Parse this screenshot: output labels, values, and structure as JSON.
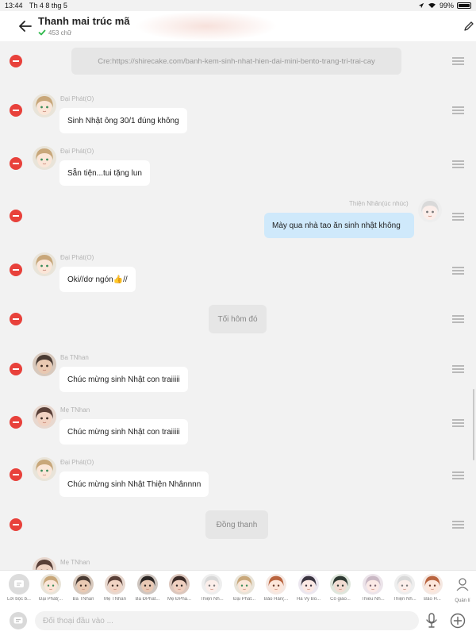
{
  "status_bar": {
    "time": "13:44",
    "date": "Th 4 8 thg 5",
    "battery": "99%"
  },
  "header": {
    "title": "Thanh mai trúc mã",
    "word_count": "453 chữ"
  },
  "messages": [
    {
      "type": "system",
      "text": "Cre:https://shirecake.com/banh-kem-sinh-nhat-hien-dai-mini-bento-trang-tri-trai-cay"
    },
    {
      "type": "left",
      "sender": "Đại Phát(O)",
      "text": "Sinh Nhật ông 30/1 đúng không",
      "avatar": "dai-phat"
    },
    {
      "type": "left",
      "sender": "Đại Phát(O)",
      "text": "Sẵn tiện...tui tặng lun",
      "avatar": "dai-phat"
    },
    {
      "type": "right",
      "sender": "Thiện Nhân(úc nhúc)",
      "text": "Mày qua nhà tao ăn sinh nhật không",
      "avatar": "thien-nhan"
    },
    {
      "type": "left",
      "sender": "Đại Phát(O)",
      "text": "Oki//dơ ngón👍//",
      "avatar": "dai-phat"
    },
    {
      "type": "system",
      "text": "Tối hôm đó"
    },
    {
      "type": "left",
      "sender": "Ba TNhan",
      "text": "Chúc mừng sinh Nhật con traiiiii",
      "avatar": "ba"
    },
    {
      "type": "left",
      "sender": "Mẹ TNhan",
      "text": "Chúc mừng sinh Nhật con traiiiii",
      "avatar": "me"
    },
    {
      "type": "left",
      "sender": "Đại Phát(O)",
      "text": "Chúc mừng sinh Nhật Thiện Nhânnnn",
      "avatar": "dai-phat"
    },
    {
      "type": "system",
      "text": "Đồng thanh"
    },
    {
      "type": "left",
      "sender": "Mẹ TNhan",
      "text": "",
      "avatar": "me"
    }
  ],
  "characters": [
    {
      "label": "Lời bộc b...",
      "avatar": "narrator"
    },
    {
      "label": "Đại Phát(...",
      "avatar": "dai-phat"
    },
    {
      "label": "Ba TNhan",
      "avatar": "ba"
    },
    {
      "label": "Mẹ TNhan",
      "avatar": "me"
    },
    {
      "label": "Ba ĐPhat...",
      "avatar": "ba-dphat"
    },
    {
      "label": "Mẹ ĐPha...",
      "avatar": "me-dphat"
    },
    {
      "label": "Thiện Nh...",
      "avatar": "thien-nhan"
    },
    {
      "label": "Đại Phát...",
      "avatar": "dai-phat"
    },
    {
      "label": "Bảo Hân(...",
      "avatar": "bao-han"
    },
    {
      "label": "Hà Vy Bồ...",
      "avatar": "ha-vy"
    },
    {
      "label": "Cô giáo...",
      "avatar": "co-giao"
    },
    {
      "label": "Thiều Nh...",
      "avatar": "thieu-nh"
    },
    {
      "label": "Thiện Nh...",
      "avatar": "thien-nhan"
    },
    {
      "label": "Bảo H...",
      "avatar": "bao-han"
    }
  ],
  "admin_label": "Quản lí",
  "input": {
    "placeholder": "Đối thoại đầu vào ..."
  },
  "colors": {
    "delete": "#e8413b",
    "my_bubble": "#cfe9fb",
    "system_bubble": "#e6e6e6",
    "verified": "#2eb84b"
  }
}
